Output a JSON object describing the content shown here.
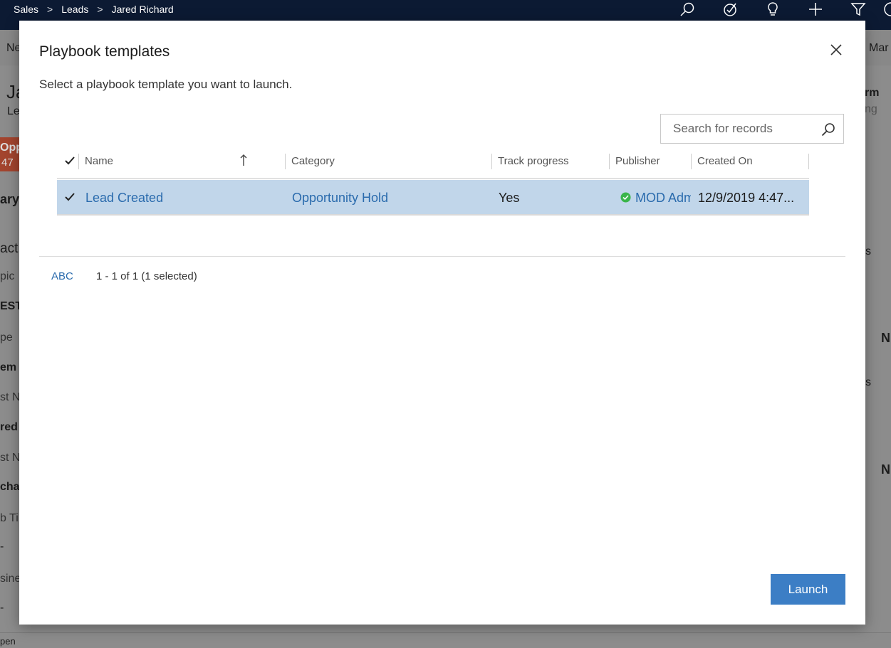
{
  "breadcrumb": [
    "Sales",
    "Leads",
    "Jared Richard"
  ],
  "top_icons": [
    "search-icon",
    "task-icon",
    "lightbulb-icon",
    "plus-icon",
    "filter-icon"
  ],
  "background": {
    "nav_left": "Ne",
    "nav_right": "Mar",
    "record_initials": "Ja",
    "record_type": "Le",
    "badge_top": "Opp",
    "badge_num": "47",
    "tab": "ary",
    "section": "act",
    "field1": "pic",
    "value1": "EST",
    "field2": "pe",
    "value2": "em b",
    "field3": "st N",
    "value3": "red",
    "field4": "st N",
    "value4": "char",
    "field5": "b Ti",
    "dash1": "-",
    "field6": "sine",
    "dash2": "-",
    "right1": "rm",
    "right2": "ng",
    "right3": "s",
    "right4": "N",
    "right5": "s",
    "right6": "N",
    "bottom_left": "pen"
  },
  "dialog": {
    "title": "Playbook templates",
    "subtitle": "Select a playbook template you want to launch.",
    "search_placeholder": "Search for records",
    "columns": [
      "Name",
      "Category",
      "Track progress",
      "Publisher",
      "Created On"
    ],
    "rows": [
      {
        "name": "Lead Created",
        "category": "Opportunity Hold",
        "track_progress": "Yes",
        "publisher": "MOD Adm",
        "created_on": "12/9/2019 4:47...",
        "selected": true
      }
    ],
    "alpha_filter": "ABC",
    "record_count": "1 - 1 of 1 (1 selected)",
    "launch_label": "Launch"
  },
  "colors": {
    "accent": "#3c7ec5",
    "link": "#2a6bad",
    "selected_row": "#c1d6ea",
    "topbar": "#0c1a33",
    "status_green": "#3ab54a",
    "badge_red": "#c4381f"
  }
}
